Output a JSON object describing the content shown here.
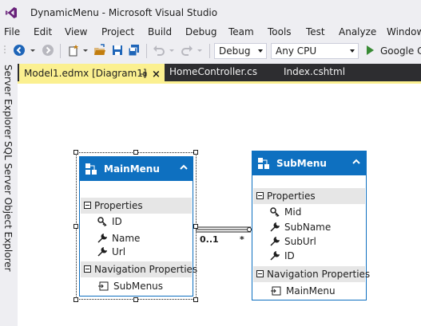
{
  "window": {
    "title": "DynamicMenu - Microsoft Visual Studio"
  },
  "menu": [
    "File",
    "Edit",
    "View",
    "Project",
    "Build",
    "Debug",
    "Team",
    "Tools",
    "Test",
    "Analyze",
    "Window"
  ],
  "toolbar": {
    "config_value": "Debug",
    "platform_value": "Any CPU",
    "run_label": "Google C"
  },
  "sidebar": {
    "server_explorer": "Server Explorer",
    "sql_explorer": "SQL Server Object Explorer"
  },
  "tabs": [
    {
      "label": "Model1.edmx [Diagram1]",
      "active": true
    },
    {
      "label": "HomeController.cs",
      "active": false
    },
    {
      "label": "Index.cshtml",
      "active": false
    }
  ],
  "diagram": {
    "entities": [
      {
        "name": "MainMenu",
        "properties_label": "Properties",
        "properties": [
          {
            "name": "ID",
            "key": true
          },
          {
            "name": "Name",
            "key": false
          },
          {
            "name": "Url",
            "key": false
          }
        ],
        "nav_label": "Navigation Properties",
        "nav_properties": [
          "SubMenus"
        ]
      },
      {
        "name": "SubMenu",
        "properties_label": "Properties",
        "properties": [
          {
            "name": "Mid",
            "key": true
          },
          {
            "name": "SubName",
            "key": false
          },
          {
            "name": "SubUrl",
            "key": false
          },
          {
            "name": "ID",
            "key": false
          }
        ],
        "nav_label": "Navigation Properties",
        "nav_properties": [
          "MainMenu"
        ]
      }
    ],
    "association": {
      "left_multiplicity": "0..1",
      "right_multiplicity": "*"
    }
  },
  "colors": {
    "entity_blue": "#0e70c0",
    "tab_active": "#fbf090",
    "chrome": "#eeeef2",
    "tabstrip": "#2d2d30"
  }
}
